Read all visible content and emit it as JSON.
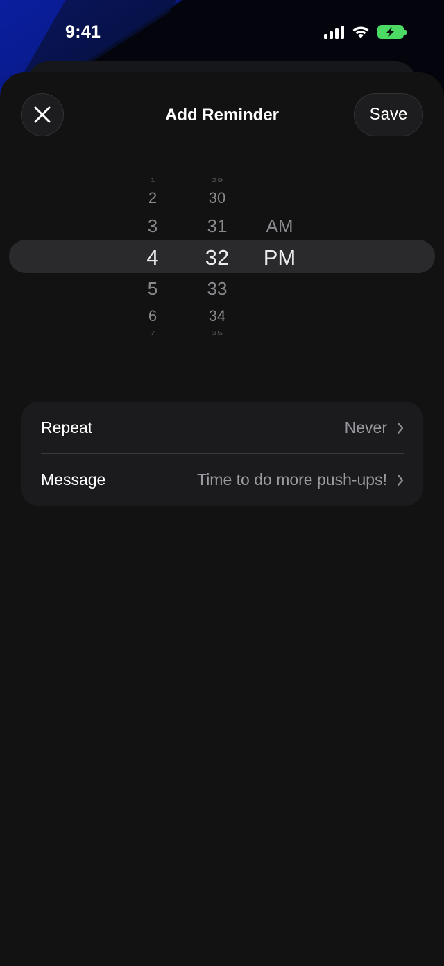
{
  "status_bar": {
    "time": "9:41",
    "signal_icon": "cellular-signal-icon",
    "wifi_icon": "wifi-icon",
    "battery_icon": "battery-charging-icon",
    "battery_color": "#4cd964"
  },
  "sheet": {
    "title": "Add Reminder",
    "close_icon": "close-icon",
    "save_label": "Save"
  },
  "picker": {
    "hours": [
      "1",
      "2",
      "3",
      "4",
      "5",
      "6",
      "7"
    ],
    "minutes": [
      "29",
      "30",
      "31",
      "32",
      "33",
      "34",
      "35"
    ],
    "periods": [
      "AM",
      "PM"
    ],
    "selected_hour": "4",
    "selected_minute": "32",
    "selected_period": "PM"
  },
  "settings": {
    "repeat_label": "Repeat",
    "repeat_value": "Never",
    "message_label": "Message",
    "message_value": "Time to do more push-ups!",
    "chevron_icon": "chevron-right-icon"
  },
  "colors": {
    "sheet_bg": "#121212",
    "card_bg": "#1b1b1d",
    "secondary_text": "#9a9aa0"
  }
}
